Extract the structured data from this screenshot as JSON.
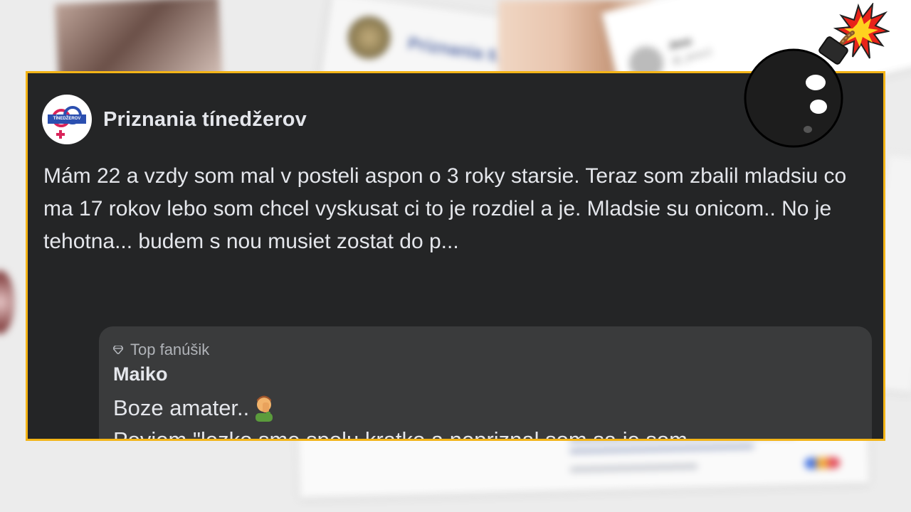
{
  "background": {
    "center_card_title": "Priznania tí...",
    "tweet_user": "Jess",
    "tweet_handle": "@_jessc2"
  },
  "post": {
    "page_name": "Priznania tínedžerov",
    "avatar_text": "TÍNEDŽEROV",
    "text": "Mám 22 a vzdy som mal v posteli aspon o 3 roky starsie. Teraz som zbalil mladsiu co ma 17 rokov lebo som chcel vyskusat ci to je rozdiel a je. Mladsie su onicom.. No je tehotna... budem s nou musiet zostat do p..."
  },
  "comment": {
    "badge": "Top fanúšik",
    "author": "Maiko",
    "line1": "Boze amater..",
    "line2": "Poviem \"lezko sme spolu kratko a nepriznal som sa je som"
  },
  "colors": {
    "frame_border": "#f3b417",
    "post_bg": "#242526",
    "comment_bg": "#3a3b3c",
    "text_primary": "#e4e6eb",
    "text_secondary": "#b0b3b8"
  },
  "icons": [
    "gem-icon",
    "facepalm-icon",
    "bomb-icon",
    "page-avatar-logo"
  ]
}
